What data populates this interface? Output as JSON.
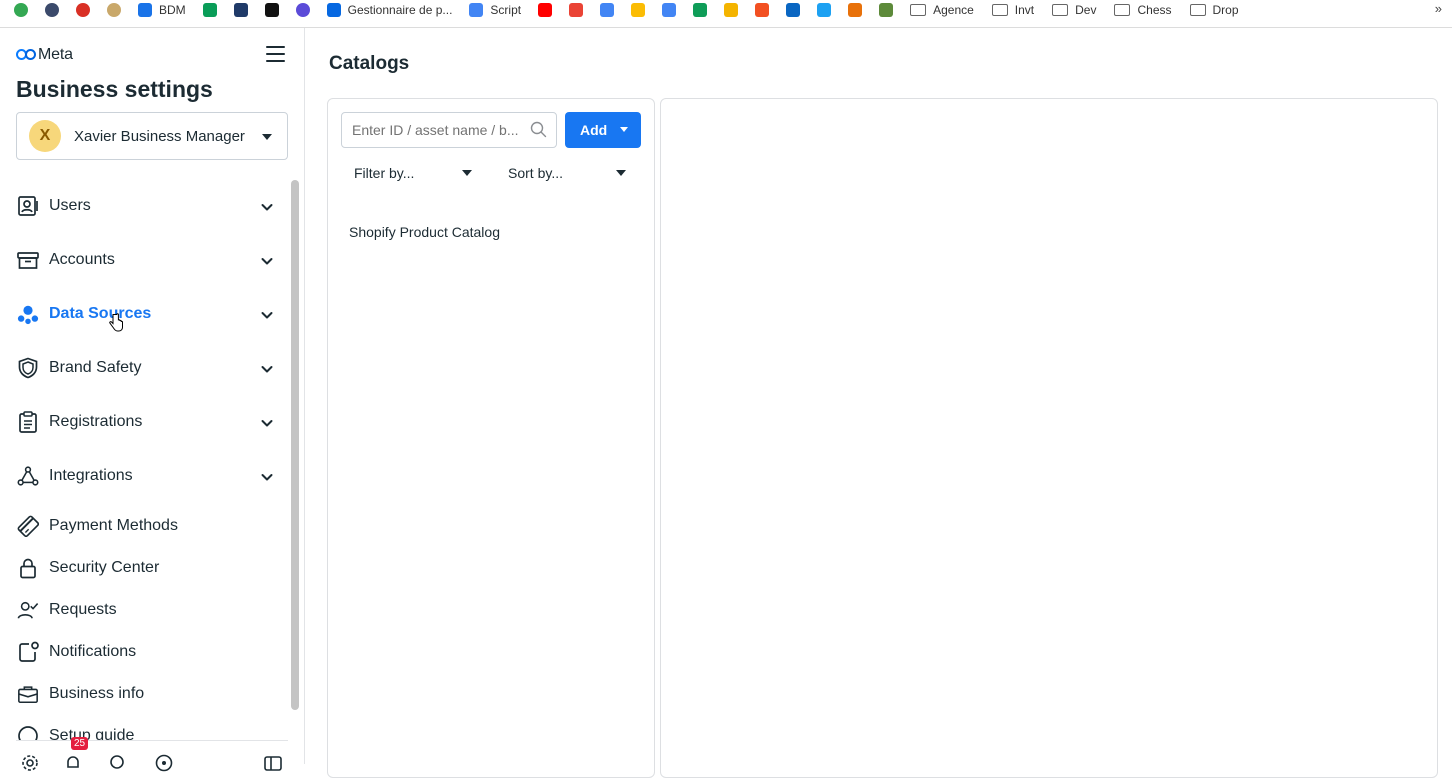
{
  "bookmarks": {
    "items": [
      {
        "label": "",
        "color": "#34a853",
        "icon": "circle-t-icon"
      },
      {
        "label": "",
        "color": "#3b4a6b",
        "icon": "eye-icon"
      },
      {
        "label": "",
        "color": "#d93025",
        "icon": "gift-icon"
      },
      {
        "label": "",
        "color": "#c9a86a",
        "icon": "badge-icon"
      },
      {
        "label": "BDM",
        "color": "#1a73e8",
        "icon": "triangle-icon"
      },
      {
        "label": "",
        "color": "#0a9d58",
        "icon": "tc-icon"
      },
      {
        "label": "",
        "color": "#1f3a68",
        "icon": "ladn-icon"
      },
      {
        "label": "",
        "color": "#111111",
        "icon": "m-icon"
      },
      {
        "label": "",
        "color": "#5b4bd8",
        "icon": "circle-icon"
      },
      {
        "label": "Gestionnaire de p...",
        "color": "#0668e1",
        "icon": "meta-icon"
      },
      {
        "label": "Script",
        "color": "#4285f4",
        "icon": "doc-icon"
      },
      {
        "label": "",
        "color": "#ff0000",
        "icon": "youtube-icon"
      },
      {
        "label": "",
        "color": "#ea4335",
        "icon": "gmail-icon"
      },
      {
        "label": "",
        "color": "#4285f4",
        "icon": "calendar-icon"
      },
      {
        "label": "",
        "color": "#fbbc04",
        "icon": "drive-icon"
      },
      {
        "label": "",
        "color": "#4285f4",
        "icon": "docs-icon"
      },
      {
        "label": "",
        "color": "#0f9d58",
        "icon": "sheets-icon"
      },
      {
        "label": "",
        "color": "#f4b400",
        "icon": "slides-icon"
      },
      {
        "label": "",
        "color": "#f25022",
        "icon": "microsoft-icon"
      },
      {
        "label": "",
        "color": "#0a66c2",
        "icon": "linkedin-icon"
      },
      {
        "label": "",
        "color": "#1da1f2",
        "icon": "twitter-icon"
      },
      {
        "label": "",
        "color": "#e8710a",
        "icon": "wr-icon"
      },
      {
        "label": "",
        "color": "#5d8a3a",
        "icon": "chess-pawn-icon"
      }
    ],
    "folders": [
      "Agence",
      "Invt",
      "Dev",
      "Chess",
      "Drop"
    ],
    "more": "»"
  },
  "sidebar": {
    "brand": "Meta",
    "title": "Business settings",
    "business": {
      "initial": "X",
      "name": "Xavier Business Manager"
    },
    "items": [
      {
        "label": "Users",
        "icon": "users-icon",
        "expandable": true,
        "active": false
      },
      {
        "label": "Accounts",
        "icon": "archive-box-icon",
        "expandable": true,
        "active": false
      },
      {
        "label": "Data Sources",
        "icon": "data-sources-icon",
        "expandable": true,
        "active": true
      },
      {
        "label": "Brand Safety",
        "icon": "shield-icon",
        "expandable": true,
        "active": false
      },
      {
        "label": "Registrations",
        "icon": "clipboard-icon",
        "expandable": true,
        "active": false
      },
      {
        "label": "Integrations",
        "icon": "integrations-icon",
        "expandable": true,
        "active": false
      },
      {
        "label": "Payment Methods",
        "icon": "credit-card-icon",
        "expandable": false,
        "active": false
      },
      {
        "label": "Security Center",
        "icon": "lock-icon",
        "expandable": false,
        "active": false
      },
      {
        "label": "Requests",
        "icon": "person-check-icon",
        "expandable": false,
        "active": false
      },
      {
        "label": "Notifications",
        "icon": "notification-icon",
        "expandable": false,
        "active": false
      },
      {
        "label": "Business info",
        "icon": "briefcase-icon",
        "expandable": false,
        "active": false
      },
      {
        "label": "Setup guide",
        "icon": "setup-guide-icon",
        "expandable": false,
        "active": false
      }
    ],
    "footer": {
      "notification_count": "25"
    }
  },
  "main": {
    "title": "Catalogs",
    "search": {
      "placeholder": "Enter ID / asset name / b...",
      "value": ""
    },
    "add_label": "Add",
    "filter_label": "Filter by...",
    "sort_label": "Sort by...",
    "catalogs": [
      "Shopify Product Catalog"
    ]
  },
  "colors": {
    "accent": "#1877f2",
    "text": "#1c2b33",
    "border": "#dddfe2"
  }
}
